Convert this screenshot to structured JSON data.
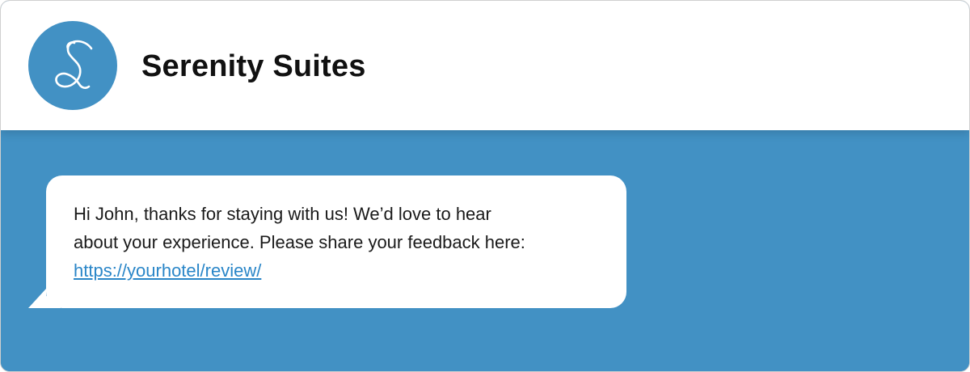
{
  "header": {
    "title": "Serenity Suites",
    "logo_icon": "script-s-logo-icon"
  },
  "message": {
    "text_line_1": "Hi John, thanks for staying with us! We’d love to hear",
    "text_line_2": "about your experience. Please share your feedback here:",
    "link": "https://yourhotel/review/"
  },
  "colors": {
    "brand_blue": "#4291c4",
    "link_blue": "#2a86c8",
    "bubble": "#ffffff"
  }
}
